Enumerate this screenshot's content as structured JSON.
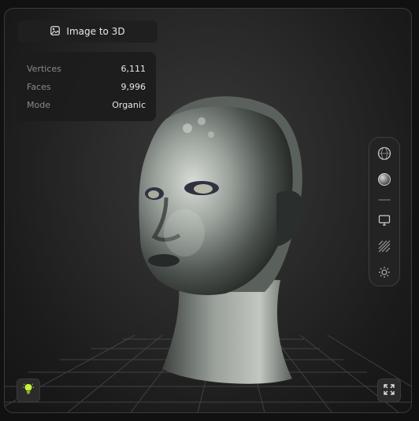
{
  "mode_tab": {
    "label": "Image to 3D",
    "icon": "image-icon"
  },
  "stats": [
    {
      "label": "Vertices",
      "value": "6,111"
    },
    {
      "label": "Faces",
      "value": "9,996"
    },
    {
      "label": "Mode",
      "value": "Organic"
    }
  ],
  "toolbar": {
    "items": [
      "wireframe-sphere-icon",
      "shaded-sphere-icon",
      "monitor-icon",
      "texture-icon",
      "lighting-icon"
    ]
  },
  "colors": {
    "bulb": "#c6f03a",
    "panel": "#1f1f1f",
    "border": "#3a3a3a"
  },
  "corner_buttons": {
    "left": "lightbulb-icon",
    "right": "fullscreen-icon"
  }
}
